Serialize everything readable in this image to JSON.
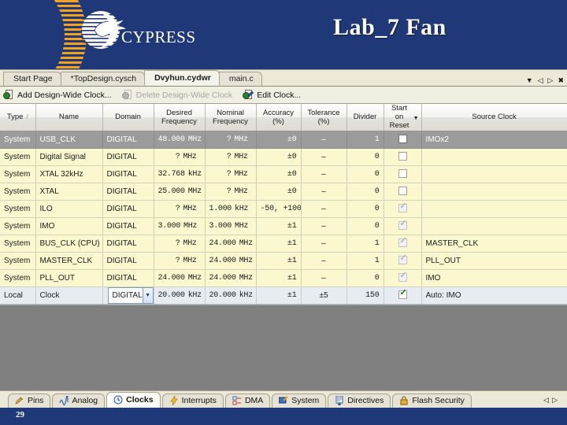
{
  "slide": {
    "title": "Lab_7 Fan",
    "logo_text": "CYPRESS",
    "number": "29",
    "bg_color": "#1f3878",
    "accent_color": "#f5a11b"
  },
  "editor_tabs": [
    {
      "label": "Start Page",
      "active": false
    },
    {
      "label": "*TopDesign.cysch",
      "active": false
    },
    {
      "label": "Dvyhun.cydwr",
      "active": true
    },
    {
      "label": "main.c",
      "active": false
    }
  ],
  "tab_nav": {
    "dropdown": "▼",
    "prev": "◁",
    "next": "▷",
    "close": "✖"
  },
  "toolbar": {
    "add_label": "Add Design-Wide Clock...",
    "delete_label": "Delete Design-Wide Clock",
    "edit_label": "Edit Clock..."
  },
  "grid": {
    "columns": [
      {
        "key": "type",
        "label": "Type",
        "sort": "/"
      },
      {
        "key": "name",
        "label": "Name"
      },
      {
        "key": "domain",
        "label": "Domain"
      },
      {
        "key": "desired",
        "label": "Desired\nFrequency"
      },
      {
        "key": "nominal",
        "label": "Nominal\nFrequency"
      },
      {
        "key": "accuracy",
        "label": "Accuracy\n(%)"
      },
      {
        "key": "tolerance",
        "label": "Tolerance\n(%)"
      },
      {
        "key": "divider",
        "label": "Divider"
      },
      {
        "key": "start",
        "label": "Start  on\nReset",
        "arrow": "▼"
      },
      {
        "key": "source",
        "label": "Source Clock"
      }
    ],
    "rows": [
      {
        "type": "System",
        "name": "USB_CLK",
        "domain": "DIGITAL",
        "desired_val": "48.000",
        "desired_unit": "MHz",
        "nominal_val": "?",
        "nominal_unit": "MHz",
        "accuracy": "±0",
        "tolerance": "–",
        "divider": "1",
        "start_checked": false,
        "start_disabled": false,
        "source": "IMOx2",
        "state": "selected"
      },
      {
        "type": "System",
        "name": "Digital Signal",
        "domain": "DIGITAL",
        "desired_val": "?",
        "desired_unit": "MHz",
        "nominal_val": "?",
        "nominal_unit": "MHz",
        "accuracy": "±0",
        "tolerance": "–",
        "divider": "0",
        "start_checked": false,
        "start_disabled": false,
        "source": "",
        "state": "normal"
      },
      {
        "type": "System",
        "name": "XTAL 32kHz",
        "domain": "DIGITAL",
        "desired_val": "32.768",
        "desired_unit": "kHz",
        "nominal_val": "?",
        "nominal_unit": "MHz",
        "accuracy": "±0",
        "tolerance": "–",
        "divider": "0",
        "start_checked": false,
        "start_disabled": false,
        "source": "",
        "state": "normal"
      },
      {
        "type": "System",
        "name": "XTAL",
        "domain": "DIGITAL",
        "desired_val": "25.000",
        "desired_unit": "MHz",
        "nominal_val": "?",
        "nominal_unit": "MHz",
        "accuracy": "±0",
        "tolerance": "–",
        "divider": "0",
        "start_checked": false,
        "start_disabled": false,
        "source": "",
        "state": "normal"
      },
      {
        "type": "System",
        "name": "ILO",
        "domain": "DIGITAL",
        "desired_val": "?",
        "desired_unit": "MHz",
        "nominal_val": "1.000",
        "nominal_unit": "kHz",
        "accuracy": "-50, +100",
        "tolerance": "–",
        "divider": "0",
        "start_checked": true,
        "start_disabled": true,
        "source": "",
        "state": "normal"
      },
      {
        "type": "System",
        "name": "IMO",
        "domain": "DIGITAL",
        "desired_val": "3.000",
        "desired_unit": "MHz",
        "nominal_val": "3.000",
        "nominal_unit": "MHz",
        "accuracy": "±1",
        "tolerance": "–",
        "divider": "0",
        "start_checked": true,
        "start_disabled": true,
        "source": "",
        "state": "normal"
      },
      {
        "type": "System",
        "name": "BUS_CLK (CPU)",
        "domain": "DIGITAL",
        "desired_val": "?",
        "desired_unit": "MHz",
        "nominal_val": "24.000",
        "nominal_unit": "MHz",
        "accuracy": "±1",
        "tolerance": "–",
        "divider": "1",
        "start_checked": true,
        "start_disabled": true,
        "source": "MASTER_CLK",
        "state": "normal"
      },
      {
        "type": "System",
        "name": "MASTER_CLK",
        "domain": "DIGITAL",
        "desired_val": "?",
        "desired_unit": "MHz",
        "nominal_val": "24.000",
        "nominal_unit": "MHz",
        "accuracy": "±1",
        "tolerance": "–",
        "divider": "1",
        "start_checked": true,
        "start_disabled": true,
        "source": "PLL_OUT",
        "state": "normal"
      },
      {
        "type": "System",
        "name": "PLL_OUT",
        "domain": "DIGITAL",
        "desired_val": "24.000",
        "desired_unit": "MHz",
        "nominal_val": "24.000",
        "nominal_unit": "MHz",
        "accuracy": "±1",
        "tolerance": "–",
        "divider": "0",
        "start_checked": true,
        "start_disabled": true,
        "source": "IMO",
        "state": "normal"
      },
      {
        "type": "Local",
        "name": "Clock",
        "domain": "DIGITAL",
        "desired_val": "20.000",
        "desired_unit": "kHz",
        "nominal_val": "20.000",
        "nominal_unit": "kHz",
        "accuracy": "±1",
        "tolerance": "±5",
        "divider": "150",
        "start_checked": true,
        "start_disabled": false,
        "source": "Auto: IMO",
        "state": "local",
        "domain_editing": true
      }
    ]
  },
  "bottom_tabs": [
    {
      "label": "Pins",
      "icon": "pins-icon",
      "active": false
    },
    {
      "label": "Analog",
      "icon": "analog-icon",
      "active": false
    },
    {
      "label": "Clocks",
      "icon": "clocks-icon",
      "active": true
    },
    {
      "label": "Interrupts",
      "icon": "interrupts-icon",
      "active": false
    },
    {
      "label": "DMA",
      "icon": "dma-icon",
      "active": false
    },
    {
      "label": "System",
      "icon": "system-icon",
      "active": false
    },
    {
      "label": "Directives",
      "icon": "directives-icon",
      "active": false
    },
    {
      "label": "Flash Security",
      "icon": "flash-security-icon",
      "active": false
    }
  ],
  "bottom_nav": {
    "prev": "◁",
    "next": "▷"
  }
}
